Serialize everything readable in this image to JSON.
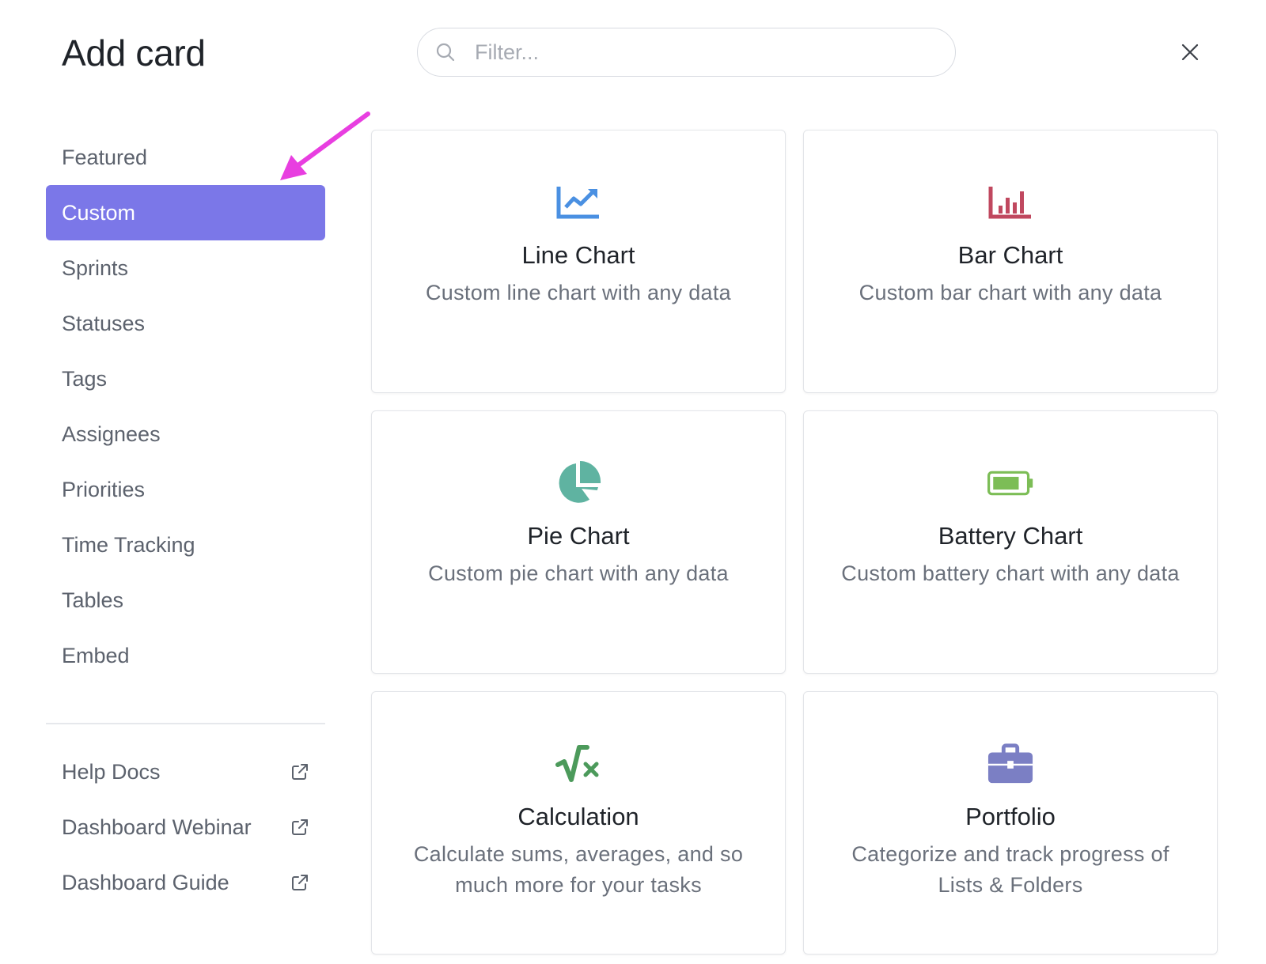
{
  "dialog": {
    "title": "Add card"
  },
  "search": {
    "placeholder": "Filter..."
  },
  "sidebar": {
    "items": [
      {
        "label": "Featured",
        "active": false
      },
      {
        "label": "Custom",
        "active": true
      },
      {
        "label": "Sprints",
        "active": false
      },
      {
        "label": "Statuses",
        "active": false
      },
      {
        "label": "Tags",
        "active": false
      },
      {
        "label": "Assignees",
        "active": false
      },
      {
        "label": "Priorities",
        "active": false
      },
      {
        "label": "Time Tracking",
        "active": false
      },
      {
        "label": "Tables",
        "active": false
      },
      {
        "label": "Embed",
        "active": false
      }
    ],
    "links": [
      {
        "label": "Help Docs",
        "icon": "external-link-icon"
      },
      {
        "label": "Dashboard Webinar",
        "icon": "external-link-icon"
      },
      {
        "label": "Dashboard Guide",
        "icon": "external-link-icon"
      }
    ]
  },
  "cards": [
    {
      "title": "Line Chart",
      "description": "Custom line chart with any data",
      "icon": "line-chart-icon",
      "color": "#4a90e2"
    },
    {
      "title": "Bar Chart",
      "description": "Custom bar chart with any data",
      "icon": "bar-chart-icon",
      "color": "#c0485f"
    },
    {
      "title": "Pie Chart",
      "description": "Custom pie chart with any data",
      "icon": "pie-chart-icon",
      "color": "#5fb3a1"
    },
    {
      "title": "Battery Chart",
      "description": "Custom battery chart with any data",
      "icon": "battery-chart-icon",
      "color": "#7cbd56"
    },
    {
      "title": "Calculation",
      "description": "Calculate sums, averages, and so much more for your tasks",
      "icon": "calculation-icon",
      "color": "#4c9a5b"
    },
    {
      "title": "Portfolio",
      "description": "Categorize and track progress of Lists & Folders",
      "icon": "portfolio-icon",
      "color": "#7b7fc4"
    }
  ],
  "colors": {
    "accent": "#7b77e8",
    "annotation_arrow": "#e83ee0"
  }
}
